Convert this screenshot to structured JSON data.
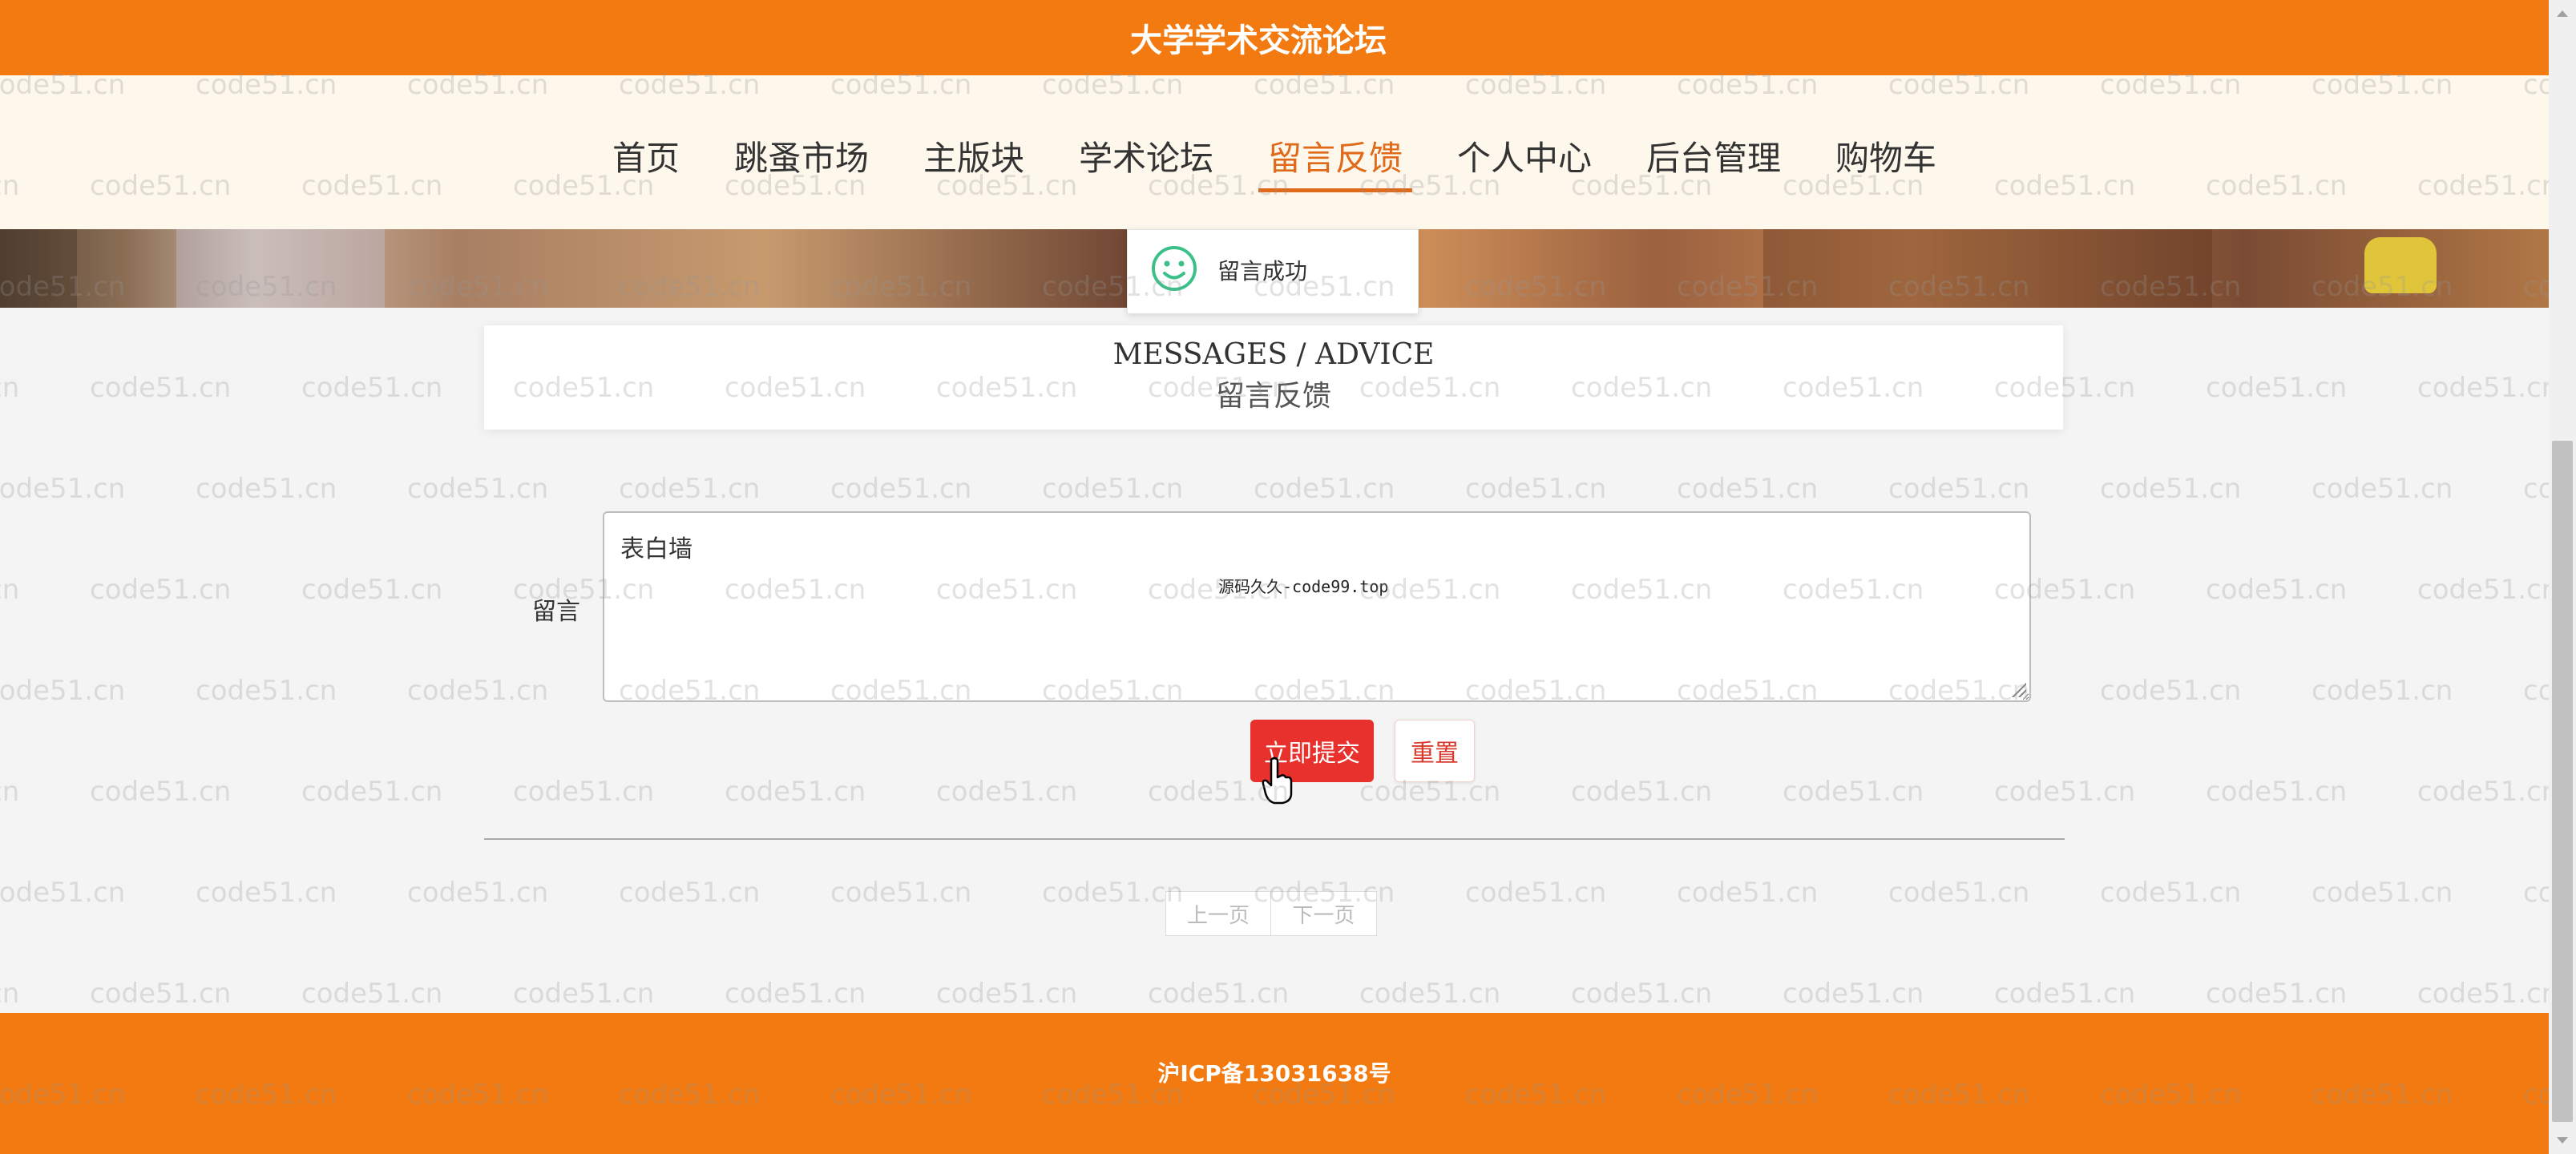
{
  "site": {
    "title": "大学学术交流论坛"
  },
  "nav": {
    "items": [
      {
        "label": "首页"
      },
      {
        "label": "跳蚤市场"
      },
      {
        "label": "主版块"
      },
      {
        "label": "学术论坛"
      },
      {
        "label": "留言反馈",
        "active": true
      },
      {
        "label": "个人中心"
      },
      {
        "label": "后台管理"
      },
      {
        "label": "购物车"
      }
    ]
  },
  "toast": {
    "message": "留言成功",
    "icon": "smile-icon"
  },
  "section": {
    "title_en": "MESSAGES / ADVICE",
    "title_cn": "留言反馈"
  },
  "form": {
    "label": "留言",
    "value": "表白墙",
    "submit_label": "立即提交",
    "reset_label": "重置"
  },
  "pager": {
    "prev_label": "上一页",
    "next_label": "下一页"
  },
  "overlay_note": "源码久久-code99.top",
  "watermark": "code51.cn",
  "footer": {
    "icp": "沪ICP备13031638号"
  },
  "colors": {
    "brand": "#f27a10",
    "active_nav": "#e0691a",
    "submit": "#e8302c",
    "toast_icon": "#3cc08a"
  }
}
